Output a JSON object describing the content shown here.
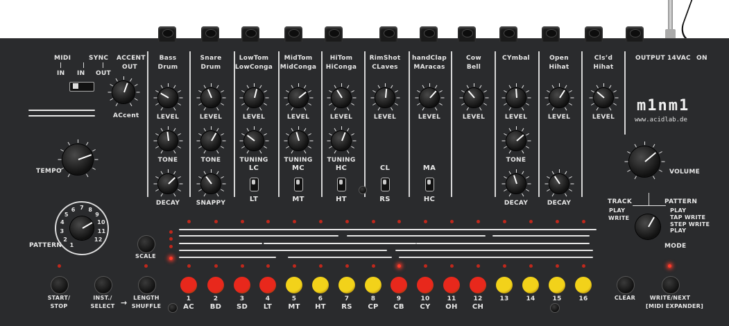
{
  "device": {
    "brand": "m1nm1",
    "url": "www.acidlab.de"
  },
  "top_labels": {
    "midi": "MIDI",
    "midi_in": "IN",
    "sync": "SYNC",
    "sync_in": "IN",
    "sync_out": "OUT",
    "accent_out": "ACCENT",
    "accent_out2": "OUT",
    "output": "OUTPUT",
    "power": "14VAC",
    "on": "ON"
  },
  "accent_knob_label": "ACcent",
  "tempo_label": "TEMPO",
  "volume_label": "VOLUME",
  "pattern_label": "PATTERN",
  "pattern_dial_numbers": [
    "1",
    "2",
    "3",
    "4",
    "5",
    "6",
    "7",
    "8",
    "9",
    "10",
    "11",
    "12"
  ],
  "mode": {
    "track": "TRACK",
    "pattern": "PATTERN",
    "track_play": "PLAY",
    "track_write": "WRITE",
    "pattern_play": "PLAY",
    "pattern_tap_write": "TAP WRITE",
    "pattern_step_write": "STEP WRITE",
    "pattern_play2": "PLAY",
    "mode_label": "MODE"
  },
  "channels": [
    {
      "name1": "Bass",
      "name2": "Drum",
      "knobs": [
        "LEVEL",
        "TONE",
        "DECAY"
      ],
      "switch": null
    },
    {
      "name1": "Snare",
      "name2": "Drum",
      "knobs": [
        "LEVEL",
        "TONE",
        "SNAPPY"
      ],
      "switch": null
    },
    {
      "name1": "LowTom",
      "name2": "LowConga",
      "knobs": [
        "LEVEL",
        "TUNING"
      ],
      "switch": {
        "top": "LC",
        "bottom": "LT"
      }
    },
    {
      "name1": "MidTom",
      "name2": "MidConga",
      "knobs": [
        "LEVEL",
        "TUNING"
      ],
      "switch": {
        "top": "MC",
        "bottom": "MT"
      }
    },
    {
      "name1": "HiTom",
      "name2": "HiConga",
      "knobs": [
        "LEVEL",
        "TUNING"
      ],
      "switch": {
        "top": "HC",
        "bottom": "HT"
      }
    },
    {
      "name1": "RimShot",
      "name2": "CLaves",
      "knobs": [
        "LEVEL"
      ],
      "switch": {
        "top": "CL",
        "bottom": "RS"
      }
    },
    {
      "name1": "handClap",
      "name2": "MAracas",
      "knobs": [
        "LEVEL"
      ],
      "switch": {
        "top": "MA",
        "bottom": "HC"
      }
    },
    {
      "name1": "Cow",
      "name2": "Bell",
      "knobs": [
        "LEVEL"
      ],
      "switch": null
    },
    {
      "name1": "CYmbal",
      "name2": "",
      "knobs": [
        "LEVEL",
        "TONE",
        "DECAY"
      ],
      "switch": null
    },
    {
      "name1": "Open",
      "name2": "Hihat",
      "knobs": [
        "LEVEL",
        "DECAY"
      ],
      "switch": null
    },
    {
      "name1": "Cls’d",
      "name2": "Hihat",
      "knobs": [
        "LEVEL"
      ],
      "switch": null
    }
  ],
  "buttons": {
    "scale": "SCALE",
    "start_stop": "START/\nSTOP",
    "inst_select": "INST./\nSELECT",
    "arrow": "→",
    "length_shuffle": "LENGTH\nSHUFFLE",
    "clear": "CLEAR",
    "write_next": "WRITE/NEXT\n[MIDI EXPANDER]"
  },
  "steps": [
    {
      "num": "1",
      "inst": "AC",
      "color": "#e8281c"
    },
    {
      "num": "2",
      "inst": "BD",
      "color": "#e8281c"
    },
    {
      "num": "3",
      "inst": "SD",
      "color": "#e8281c"
    },
    {
      "num": "4",
      "inst": "LT",
      "color": "#e8281c"
    },
    {
      "num": "5",
      "inst": "MT",
      "color": "#f2d21a"
    },
    {
      "num": "6",
      "inst": "HT",
      "color": "#f2d21a"
    },
    {
      "num": "7",
      "inst": "RS",
      "color": "#f2d21a"
    },
    {
      "num": "8",
      "inst": "CP",
      "color": "#f2d21a"
    },
    {
      "num": "9",
      "inst": "CB",
      "color": "#e8281c"
    },
    {
      "num": "10",
      "inst": "CY",
      "color": "#e8281c"
    },
    {
      "num": "11",
      "inst": "OH",
      "color": "#e8281c"
    },
    {
      "num": "12",
      "inst": "CH",
      "color": "#e8281c"
    },
    {
      "num": "13",
      "inst": "",
      "color": "#f2d21a"
    },
    {
      "num": "14",
      "inst": "",
      "color": "#f2d21a"
    },
    {
      "num": "15",
      "inst": "",
      "color": "#f2d21a"
    },
    {
      "num": "16",
      "inst": "",
      "color": "#f2d21a"
    }
  ]
}
